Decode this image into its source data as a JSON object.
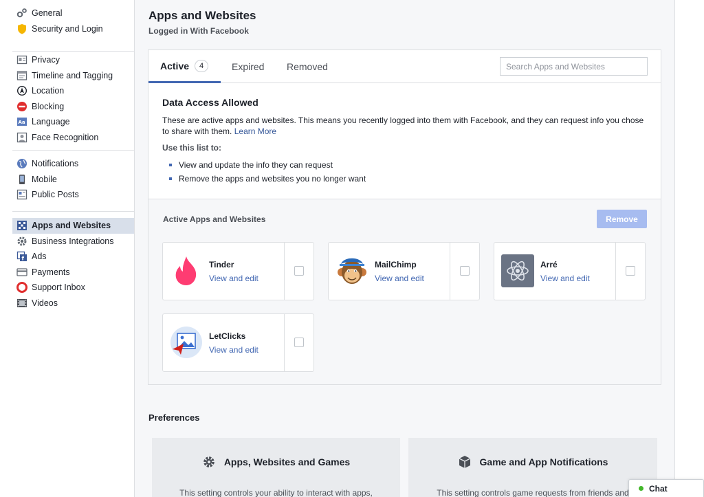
{
  "sidebar": {
    "group1": [
      {
        "label": "General",
        "icon": "gears-icon"
      },
      {
        "label": "Security and Login",
        "icon": "shield-icon"
      }
    ],
    "group2": [
      {
        "label": "Privacy",
        "icon": "privacy-icon"
      },
      {
        "label": "Timeline and Tagging",
        "icon": "timeline-icon"
      },
      {
        "label": "Location",
        "icon": "location-icon"
      },
      {
        "label": "Blocking",
        "icon": "blocking-icon"
      },
      {
        "label": "Language",
        "icon": "language-icon"
      },
      {
        "label": "Face Recognition",
        "icon": "face-recognition-icon"
      }
    ],
    "group3": [
      {
        "label": "Notifications",
        "icon": "globe-icon"
      },
      {
        "label": "Mobile",
        "icon": "mobile-icon"
      },
      {
        "label": "Public Posts",
        "icon": "public-posts-icon"
      }
    ],
    "group4": [
      {
        "label": "Apps and Websites",
        "icon": "apps-icon",
        "active": true
      },
      {
        "label": "Business Integrations",
        "icon": "business-gear-icon"
      },
      {
        "label": "Ads",
        "icon": "ads-icon"
      },
      {
        "label": "Payments",
        "icon": "payments-icon"
      },
      {
        "label": "Support Inbox",
        "icon": "support-icon"
      },
      {
        "label": "Videos",
        "icon": "videos-icon"
      }
    ]
  },
  "header": {
    "title": "Apps and Websites",
    "subtitle": "Logged in With Facebook"
  },
  "tabs": {
    "active_label": "Active",
    "active_count": "4",
    "expired_label": "Expired",
    "removed_label": "Removed"
  },
  "search": {
    "placeholder": "Search Apps and Websites"
  },
  "info": {
    "title": "Data Access Allowed",
    "description": "These are active apps and websites. This means you recently logged into them with Facebook, and they can request info you chose to share with them.",
    "learn_more": "Learn More",
    "use_title": "Use this list to:",
    "bullets": [
      "View and update the info they can request",
      "Remove the apps and websites you no longer want"
    ]
  },
  "apps_section": {
    "title": "Active Apps and Websites",
    "remove_label": "Remove",
    "edit_label": "View and edit",
    "apps": [
      {
        "name": "Tinder",
        "icon": "tinder-flame-icon"
      },
      {
        "name": "MailChimp",
        "icon": "mailchimp-monkey-icon"
      },
      {
        "name": "Arré",
        "icon": "atom-icon"
      },
      {
        "name": "LetClicks",
        "icon": "letclicks-image-icon"
      }
    ]
  },
  "preferences": {
    "title": "Preferences",
    "cards": [
      {
        "title": "Apps, Websites and Games",
        "icon": "gear-icon",
        "text": "This setting controls your ability to interact with apps,"
      },
      {
        "title": "Game and App Notifications",
        "icon": "cube-icon",
        "text": "This setting controls game requests from friends and"
      }
    ]
  },
  "chat": {
    "label": "Chat",
    "status_color": "#42b72a"
  },
  "colors": {
    "accent": "#4267b2",
    "link": "#365899",
    "active_nav_bg": "#d8dfea",
    "remove_disabled": "#a7bcf0"
  }
}
